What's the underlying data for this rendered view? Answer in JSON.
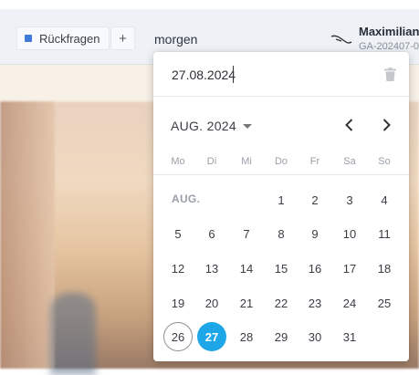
{
  "toolbar": {
    "tag_label": "Rückfragen",
    "plus_label": "+",
    "due_text": "morgen",
    "user_name": "Maximilian",
    "user_sub": "GA-202407-0"
  },
  "colors": {
    "accent": "#1ea7e8",
    "tag": "#3f79d8"
  },
  "picker": {
    "date_value": "27.08.2024",
    "month_label": "AUG. 2024",
    "grid_month_label": "AUG.",
    "weekdays": [
      "Mo",
      "Di",
      "Mi",
      "Do",
      "Fr",
      "Sa",
      "So"
    ],
    "weeks": [
      [
        null,
        null,
        null,
        1,
        2,
        3,
        4
      ],
      [
        5,
        6,
        7,
        8,
        9,
        10,
        11
      ],
      [
        12,
        13,
        14,
        15,
        16,
        17,
        18
      ],
      [
        19,
        20,
        21,
        22,
        23,
        24,
        25
      ],
      [
        26,
        27,
        28,
        29,
        30,
        31,
        null
      ]
    ],
    "today_day": 26,
    "selected_day": 27
  }
}
